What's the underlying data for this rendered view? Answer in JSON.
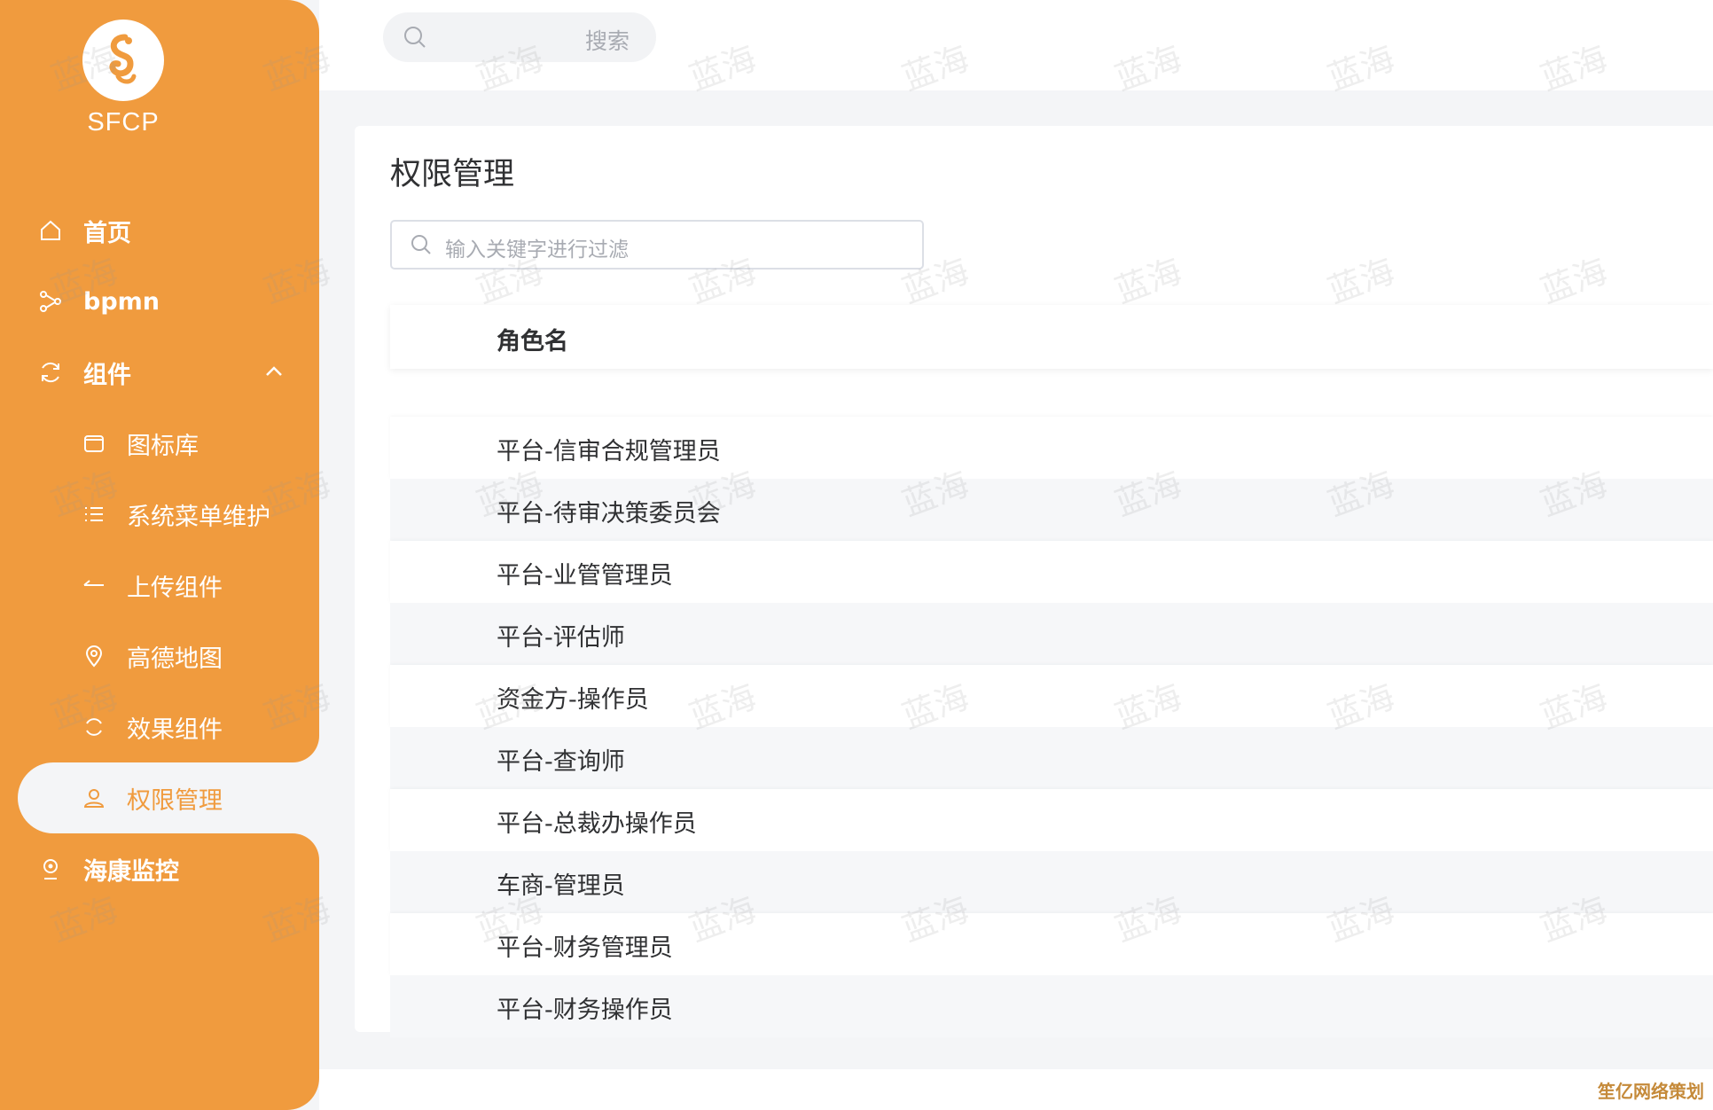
{
  "app": {
    "logo_text": "SFCP"
  },
  "header": {
    "search_placeholder": "搜索"
  },
  "sidebar": {
    "items": [
      {
        "label": "首页",
        "icon": "home-icon"
      },
      {
        "label": "bpmn",
        "icon": "share-nodes-icon"
      },
      {
        "label": "组件",
        "icon": "refresh-icon",
        "expanded": true
      },
      {
        "label": "图标库",
        "icon": "window-icon"
      },
      {
        "label": "系统菜单维护",
        "icon": "list-icon"
      },
      {
        "label": "上传组件",
        "icon": "back-arrow-icon"
      },
      {
        "label": "高德地图",
        "icon": "location-pin-icon"
      },
      {
        "label": "效果组件",
        "icon": "refresh-small-icon"
      },
      {
        "label": "权限管理",
        "icon": "user-icon",
        "active": true
      },
      {
        "label": "海康监控",
        "icon": "camera-icon"
      }
    ]
  },
  "main": {
    "title": "权限管理",
    "filter_placeholder": "输入关键字进行过滤",
    "table": {
      "header": "角色名",
      "rows": [
        "平台-信审合规管理员",
        "平台-待审决策委员会",
        "平台-业管管理员",
        "平台-评估师",
        "资金方-操作员",
        "平台-查询师",
        "平台-总裁办操作员",
        "车商-管理员",
        "平台-财务管理员",
        "平台-财务操作员"
      ]
    }
  },
  "watermark": "蓝海",
  "corner_mark": "笙亿网络策划",
  "colors": {
    "accent": "#f09b3e",
    "background": "#f4f5f7"
  }
}
